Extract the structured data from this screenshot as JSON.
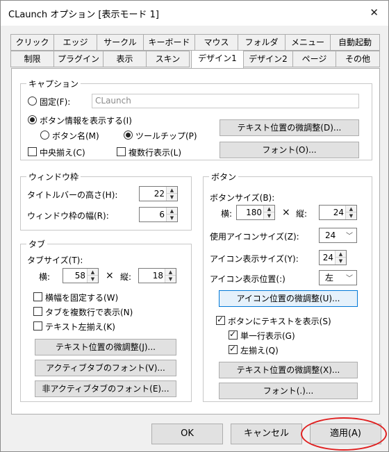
{
  "window": {
    "title": "CLaunch オプション [表示モード 1]",
    "close": "✕"
  },
  "tabs_row1": [
    "クリック",
    "エッジ",
    "サークル",
    "キーボード",
    "マウス",
    "フォルダ",
    "メニュー",
    "自動起動"
  ],
  "tabs_row2": [
    "制限",
    "プラグイン",
    "表示",
    "スキン",
    "デザイン1",
    "デザイン2",
    "ページ",
    "その他"
  ],
  "active_tab": "デザイン1",
  "caption": {
    "title": "キャプション",
    "fixed_label": "固定(F):",
    "fixed_value": "CLaunch",
    "show_button_info": "ボタン情報を表示する(I)",
    "button_name": "ボタン名(M)",
    "tooltip": "ツールチップ(P)",
    "center": "中央揃え(C)",
    "multiline": "複数行表示(L)",
    "text_pos_btn": "テキスト位置の微調整(D)...",
    "font_btn": "フォント(O)..."
  },
  "window_frame": {
    "title": "ウィンドウ枠",
    "titlebar_height_label": "タイトルバーの高さ(H):",
    "titlebar_height": "22",
    "frame_width_label": "ウィンドウ枠の幅(R):",
    "frame_width": "6"
  },
  "tab_group": {
    "title": "タブ",
    "tab_size_label": "タブサイズ(T):",
    "width_label": "横:",
    "width": "58",
    "times": "×",
    "height_label": "縦:",
    "height": "18",
    "fixed_width": "横幅を固定する(W)",
    "multirow": "タブを複数行で表示(N)",
    "text_left": "テキスト左揃え(K)",
    "text_pos_btn": "テキスト位置の微調整(J)...",
    "active_font_btn": "アクティブタブのフォント(V)...",
    "inactive_font_btn": "非アクティブタブのフォント(E)..."
  },
  "button_group": {
    "title": "ボタン",
    "button_size_label": "ボタンサイズ(B):",
    "width_label": "横:",
    "width": "180",
    "times": "×",
    "height_label": "縦:",
    "height": "24",
    "use_icon_size_label": "使用アイコンサイズ(Z):",
    "use_icon_size": "24",
    "icon_display_size_label": "アイコン表示サイズ(Y):",
    "icon_display_size": "24",
    "icon_pos_label": "アイコン表示位置(:)",
    "icon_pos": "左",
    "icon_pos_btn": "アイコン位置の微調整(U)...",
    "show_text": "ボタンにテキストを表示(S)",
    "single_line": "単一行表示(G)",
    "left_align": "左揃え(Q)",
    "text_pos_btn": "テキスト位置の微調整(X)...",
    "font_btn": "フォント(.)..."
  },
  "footer": {
    "ok": "OK",
    "cancel": "キャンセル",
    "apply": "適用(A)"
  }
}
